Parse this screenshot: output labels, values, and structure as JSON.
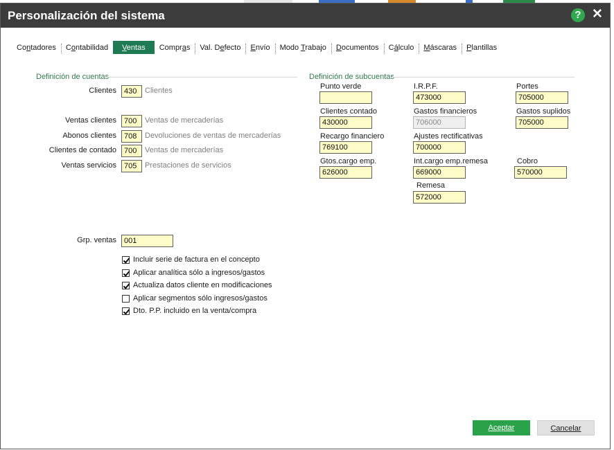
{
  "window": {
    "title": "Personalización del sistema"
  },
  "tabs": [
    {
      "label": "Contadores",
      "active": false
    },
    {
      "label": "Contabilidad",
      "active": false
    },
    {
      "label": "Ventas",
      "active": true
    },
    {
      "label": "Compras",
      "active": false
    },
    {
      "label": "Val. Defecto",
      "active": false
    },
    {
      "label": "Envío",
      "active": false
    },
    {
      "label": "Modo Trabajo",
      "active": false
    },
    {
      "label": "Documentos",
      "active": false
    },
    {
      "label": "Cálculo",
      "active": false
    },
    {
      "label": "Máscaras",
      "active": false
    },
    {
      "label": "Plantillas",
      "active": false
    }
  ],
  "cuentas": {
    "title": "Definición de cuentas",
    "rows": [
      {
        "label": "Clientes",
        "value": "430",
        "desc": "Clientes"
      },
      {
        "label": "Ventas clientes",
        "value": "700",
        "desc": "Ventas de mercaderías"
      },
      {
        "label": "Abonos clientes",
        "value": "708",
        "desc": "Devoluciones de ventas de mercaderías"
      },
      {
        "label": "Clientes de contado",
        "value": "700",
        "desc": "Ventas de mercaderías"
      },
      {
        "label": "Ventas servicios",
        "value": "705",
        "desc": "Prestaciones de servicios"
      }
    ]
  },
  "subcuentas": {
    "title": "Definición de subcuentas",
    "fields": [
      {
        "label": "Punto verde",
        "value": ""
      },
      {
        "label": "I.R.P.F.",
        "value": "473000"
      },
      {
        "label": "Portes",
        "value": "705000"
      },
      {
        "label": "Clientes contado",
        "value": "430000"
      },
      {
        "label": "Gastos financieros",
        "value": "706000"
      },
      {
        "label": "Gastos suplidos",
        "value": "705000"
      },
      {
        "label": "Recargo financiero",
        "value": "769100"
      },
      {
        "label": "Ajustes rectificativas",
        "value": "700000"
      },
      {
        "label": "Gtos.cargo emp.",
        "value": "626000"
      },
      {
        "label": "Int.cargo emp.remesa",
        "value": "669000"
      },
      {
        "label": "Cobro",
        "value": "570000"
      },
      {
        "label": "Remesa",
        "value": "572000"
      }
    ]
  },
  "grp_ventas": {
    "label": "Grp. ventas",
    "value": "001"
  },
  "options": [
    {
      "label": "Incluir serie de factura en el concepto",
      "checked": true
    },
    {
      "label": "Aplicar analítica sólo a ingresos/gastos",
      "checked": true
    },
    {
      "label": "Actualiza datos cliente en modificaciones",
      "checked": true
    },
    {
      "label": "Aplicar segmentos sólo ingresos/gastos",
      "checked": false
    },
    {
      "label": "Dto. P.P. incluido en la venta/compra",
      "checked": true
    }
  ],
  "buttons": {
    "accept": "Aceptar",
    "cancel": "Cancelar"
  },
  "colors": {
    "titlebar": "#3c3c3c",
    "accent": "#1e7a52",
    "accept": "#2aa24a",
    "field_bg": "#fdfcc8"
  }
}
